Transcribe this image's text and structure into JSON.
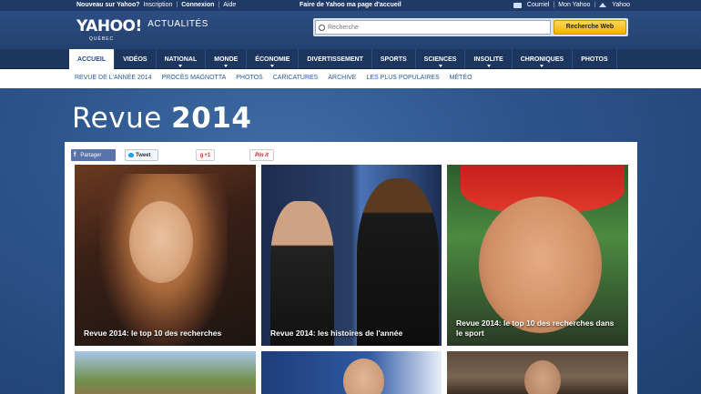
{
  "topbar": {
    "new_label": "Nouveau sur Yahoo?",
    "signup": "Inscription",
    "login": "Connexion",
    "help": "Aide",
    "homepage": "Faire de Yahoo ma page d'accueil",
    "mail": "Courriel",
    "my_yahoo": "Mon Yahoo",
    "yahoo": "Yahoo"
  },
  "logo": {
    "brand": "YAHOO!",
    "section": "ACTUALITÉS",
    "region": "QUÉBEC"
  },
  "search": {
    "placeholder": "Recherche",
    "button": "Recherche Web"
  },
  "mainnav": [
    "ACCUEIL",
    "VIDÉOS",
    "NATIONAL",
    "MONDE",
    "ÉCONOMIE",
    "DIVERTISSEMENT",
    "SPORTS",
    "SCIENCES",
    "INSOLITE",
    "CHRONIQUES",
    "PHOTOS"
  ],
  "subnav": [
    "REVUE DE L'ANNÉE 2014",
    "PROCÈS MAGNOTTA",
    "PHOTOS",
    "CARICATURES",
    "ARCHIVE",
    "LES PLUS POPULAIRES",
    "MÉTÉO"
  ],
  "page_title": {
    "light": "Revue",
    "bold": "2014"
  },
  "share": {
    "facebook": "Partager",
    "twitter": "Tweet",
    "gplus": "+1",
    "pinterest": "Pin it"
  },
  "tiles": [
    {
      "caption": "Revue 2014: le top 10 des recherches"
    },
    {
      "caption": "Revue 2014: les histoires de l'année"
    },
    {
      "caption": "Revue 2014: le top 10 des recherches dans le sport"
    }
  ],
  "colors": {
    "background": "#2b4a7a",
    "nav": "#1d3660",
    "search_button": "#f4b400",
    "link": "#2d5b96"
  }
}
